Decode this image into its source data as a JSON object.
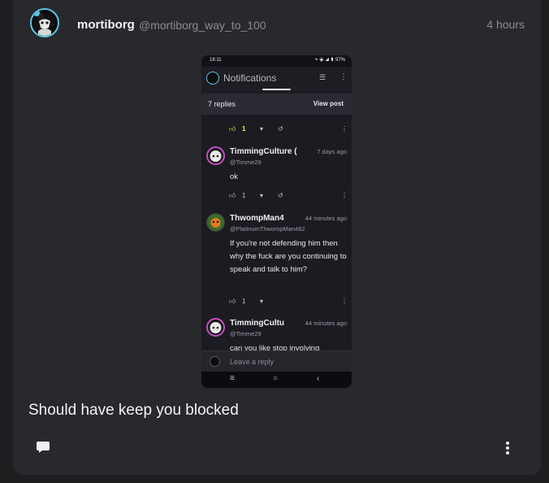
{
  "post": {
    "author_name": "mortiborg",
    "author_handle": "@mortiborg_way_to_100",
    "time": "4 hours",
    "text": "Should have keep you blocked"
  },
  "screenshot": {
    "status_time": "18:11",
    "status_icons": "⌖ ◈ ◢ ▮ 97%",
    "title": "Notifications",
    "replies_count": "7 replies",
    "view_post": "View post",
    "top_actions": {
      "likes": "1"
    },
    "comments": [
      {
        "name": "TimmingCulture (",
        "handle": "@Timme29",
        "time": "7 days ago",
        "text": "ok",
        "likes": "1"
      },
      {
        "name": "ThwompMan4",
        "handle": "@PlatinumThwompMan482",
        "time": "44 minutes ago",
        "text": "If you're not defending him then why the fuck are you continuing to speak and talk to him?",
        "likes": "1"
      },
      {
        "name": "TimmingCultu",
        "handle": "@Timme29",
        "time": "44 minutes ago",
        "text": "can you like stop involving"
      }
    ],
    "reply_placeholder": "Leave a reply",
    "accent_color": "#e8ff3a"
  },
  "colors": {
    "background": "#1d1e20",
    "card": "#28292c",
    "avatar_ring": "#5cc6e8"
  }
}
